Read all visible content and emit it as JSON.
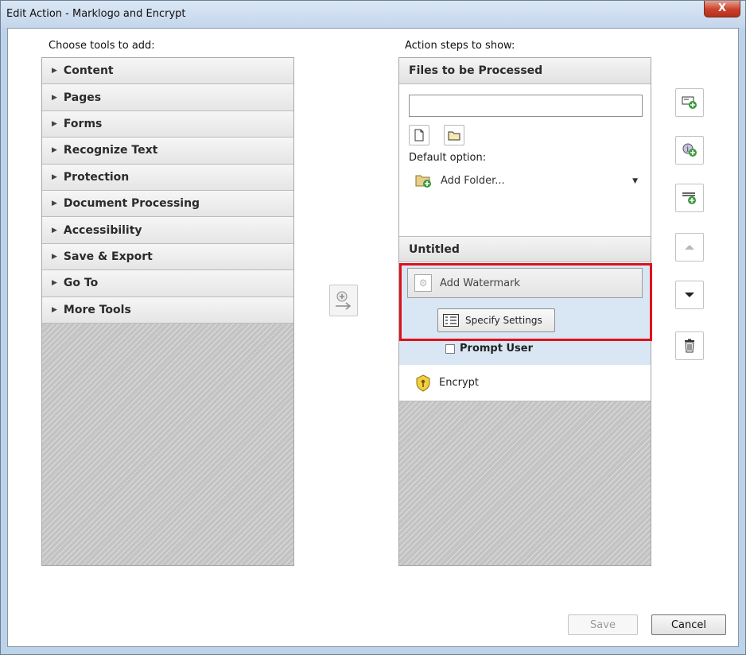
{
  "window": {
    "title": "Edit Action - Marklogo and Encrypt",
    "close_label": "X"
  },
  "left_panel": {
    "label": "Choose tools to add:",
    "items": [
      {
        "label": "Content"
      },
      {
        "label": "Pages"
      },
      {
        "label": "Forms"
      },
      {
        "label": "Recognize Text"
      },
      {
        "label": "Protection"
      },
      {
        "label": "Document Processing"
      },
      {
        "label": "Accessibility"
      },
      {
        "label": "Save & Export"
      },
      {
        "label": "Go To"
      },
      {
        "label": "More Tools"
      }
    ]
  },
  "right_panel": {
    "label": "Action steps to show:",
    "files_header": "Files to be Processed",
    "file_input_value": "",
    "default_option_label": "Default option:",
    "default_option_value": "Add Folder...",
    "untitled_header": "Untitled",
    "watermark_step": "Add Watermark",
    "specify_settings": "Specify Settings",
    "prompt_user": "Prompt User",
    "prompt_user_checked": false,
    "encrypt_step": "Encrypt"
  },
  "side_toolbar": {
    "icons": [
      "add-file-icon",
      "add-instruction-icon",
      "add-separator-icon",
      "move-up-icon",
      "move-down-icon",
      "trash-icon"
    ]
  },
  "footer": {
    "save_label": "Save",
    "cancel_label": "Cancel"
  },
  "colors": {
    "highlight": "#e0101b",
    "selected_step_bg": "#d9e7f4"
  }
}
